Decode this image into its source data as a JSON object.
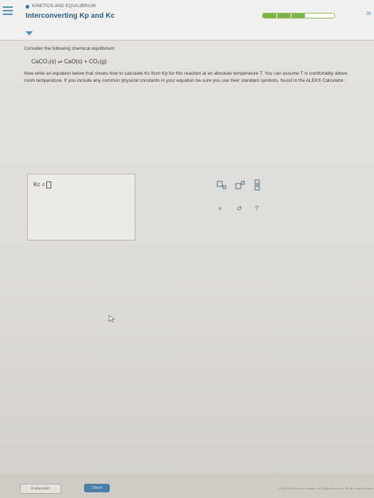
{
  "header": {
    "subtitle": "KINETICS AND EQUILIBRIUM",
    "title": "Interconverting Kp and Kc",
    "progress": {
      "completed": 3,
      "total": 5
    },
    "corner_label": "Je"
  },
  "problem": {
    "intro": "Consider the following chemical equilibrium:",
    "equation": "CaCO₃(s) ⇌ CaO(s) + CO₂(g)",
    "instruction": "Now write an equation below that shows how to calculate Kc from Kp for this reaction at an absolute temperature T. You can assume T is comfortably above room temperature. If you include any common physical constants in your equation be sure you use their standard symbols, found in the ALEKS Calculator."
  },
  "answer": {
    "label": "Kc ="
  },
  "toolbar": {
    "subscript_icon": "subscript-icon",
    "superscript_icon": "superscript-icon",
    "fraction_icon": "fraction-icon",
    "clear_icon": "clear-icon",
    "undo_icon": "undo-icon",
    "help_icon": "help-icon",
    "clear_glyph": "×",
    "undo_glyph": "↺",
    "help_glyph": "?"
  },
  "buttons": {
    "explanation": "Explanation",
    "check": "Check"
  },
  "footer": {
    "text": "© 2021 McGraw-Hill Education. All Rights Reserved. Terms of Use | Privacy"
  }
}
